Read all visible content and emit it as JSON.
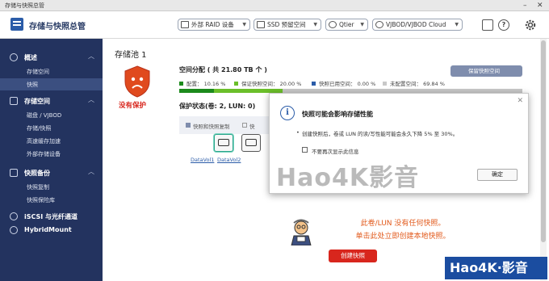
{
  "window": {
    "title": "存储与快照总管",
    "min": "–",
    "close": "✕"
  },
  "app": {
    "title": "存储与快照总管"
  },
  "toolbar": {
    "raid_label": "外部 RAID 设备",
    "ssd_label": "SSD 预留空间",
    "qtier_label": "Qtier",
    "vjbod_label": "VJBOD/VJBOD Cloud",
    "help": "?",
    "icons": [
      "search-icon",
      "help-icon",
      "settings-icon"
    ]
  },
  "sidebar": {
    "overview": {
      "label": "概述",
      "items": [
        "存储空间",
        "快照"
      ]
    },
    "storage": {
      "label": "存储空间",
      "items": [
        "磁盘 / VJBOD",
        "存储/快照",
        "高速缓存加速",
        "外部存储设备"
      ]
    },
    "backup": {
      "label": "快照备份",
      "items": [
        "快照复制",
        "快照保险库"
      ]
    },
    "iscsi": {
      "label": "iSCSI 与光纤通道"
    },
    "hybrid": {
      "label": "HybridMount"
    },
    "active_item": "快照"
  },
  "main": {
    "pool_title": "存储池 1",
    "no_protection": "没有保护",
    "alloc_title": "空间分配 ( 共 21.80 TB 个 )",
    "legend": [
      {
        "label": "配置：",
        "value": "10.16 %",
        "color": "#1c8a1c"
      },
      {
        "label": "保证快照空间：",
        "value": "20.00 %",
        "color": "#6bbf2a"
      },
      {
        "label": "快照已用空间：",
        "value": "0.00 %",
        "color": "#2b5ca8"
      },
      {
        "label": "未配置空间：",
        "value": "69.84 %",
        "color": "#c8c8c8"
      }
    ],
    "manage_button": "保留快照空间",
    "protection_title": "保护状态(卷: 2, LUN: 0)",
    "table_head_1": "快照和快照复制",
    "table_head_2": "快",
    "volumes": [
      "DataVol1",
      "DataVol2"
    ],
    "empty_line1": "此卷/LUN 没有任何快照。",
    "empty_line2": "单击此处立即创建本地快照。",
    "create_button": "创建快照"
  },
  "dialog": {
    "title": "快照可能会影响存储性能",
    "message": "创建快照后，卷或 LUN 的读/写性能可能会永久下降 5% 至 30%。",
    "checkbox_label": "不要再次显示此信息",
    "ok": "确定",
    "close": "✕",
    "info": "i"
  },
  "watermark": {
    "center": "Hao4K影音",
    "corner": "Hao4K·影音"
  }
}
